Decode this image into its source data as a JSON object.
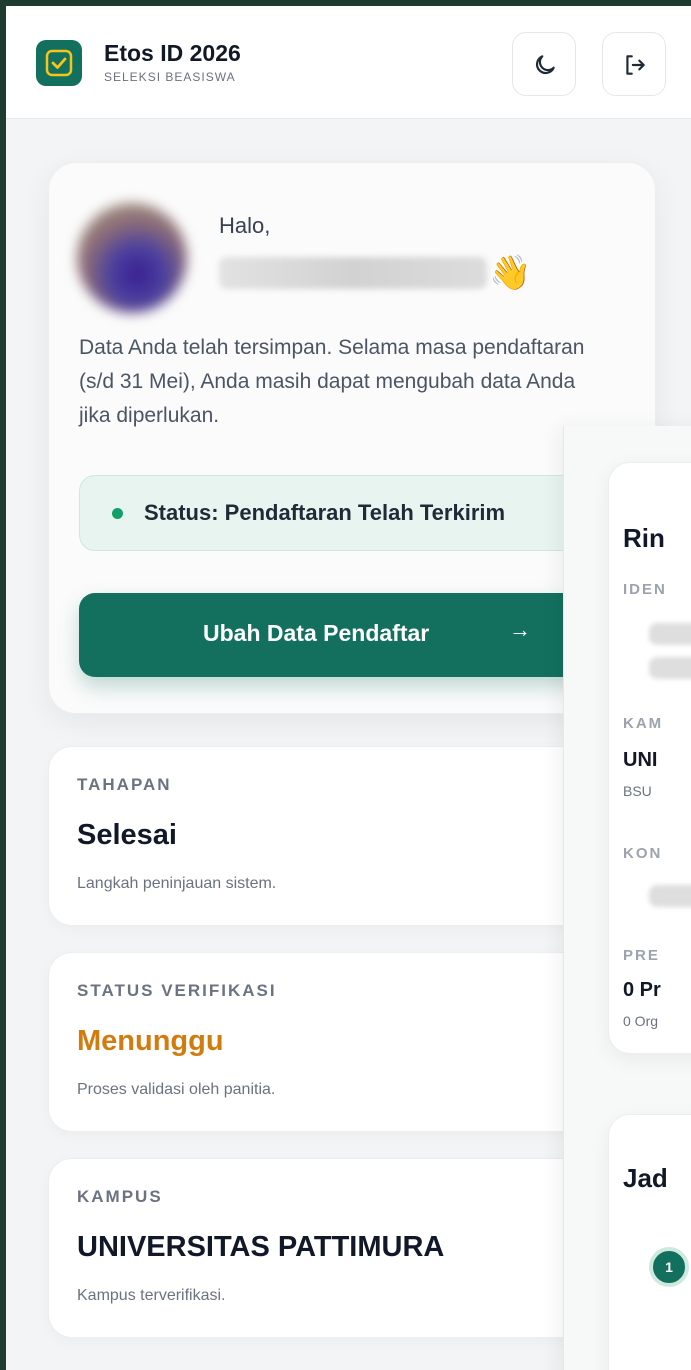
{
  "header": {
    "title": "Etos ID 2026",
    "subtitle": "SELEKSI BEASISWA",
    "logo_icon": "check-badge-icon",
    "theme_icon": "moon-icon",
    "logout_icon": "logout-icon"
  },
  "greeting": {
    "hello": "Halo,",
    "name": "",
    "wave": "👋",
    "message": "Data Anda telah tersimpan. Selama masa pendaftaran (s/d 31 Mei), Anda masih dapat mengubah data Anda jika diperlukan.",
    "status": "Status: Pendaftaran Telah Terkirim",
    "cta_label": "Ubah Data Pendaftar",
    "cta_arrow": "→"
  },
  "cards": {
    "tahapan": {
      "eyebrow": "TAHAPAN",
      "value": "Selesai",
      "sub": "Langkah peninjauan sistem."
    },
    "verifikasi": {
      "eyebrow": "STATUS VERIFIKASI",
      "value": "Menunggu",
      "sub": "Proses validasi oleh panitia."
    },
    "kampus": {
      "eyebrow": "KAMPUS",
      "value": "UNIVERSITAS PATTIMURA",
      "sub": "Kampus terverifikasi."
    }
  },
  "right_panel": {
    "title": "Rin",
    "label_identitas": "IDEN",
    "label_kampus": "KAM",
    "kampus_value": "UNI",
    "kampus_sub": "BSU",
    "label_kontak": "KON",
    "label_prestasi": "PRE",
    "prestasi_value": "0 Pr",
    "prestasi_sub": "0 Org",
    "jadwal_title": "Jad",
    "step_number": "1"
  },
  "colors": {
    "brand": "#13705f",
    "pending": "#d27c10",
    "status_dot": "#12a06a"
  }
}
